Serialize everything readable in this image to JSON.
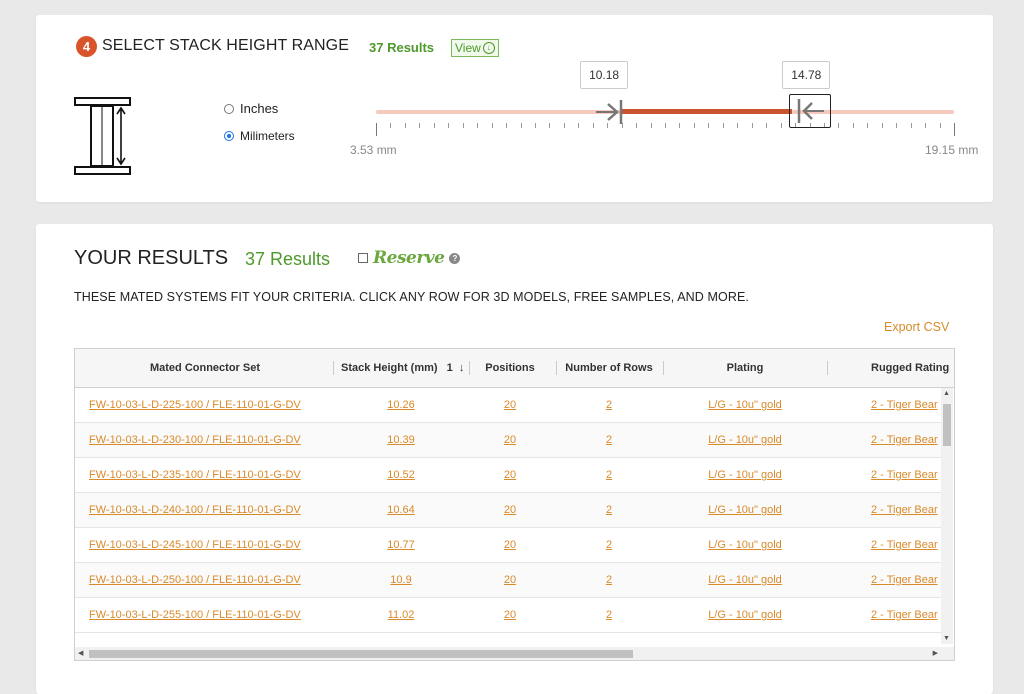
{
  "stack_range": {
    "step_number": "4",
    "title": "SELECT STACK HEIGHT RANGE",
    "results": "37 Results",
    "view_label": "View",
    "units": {
      "inches": "Inches",
      "millimeters": "Milimeters",
      "selected": "millimeters"
    },
    "slider": {
      "min_label": "3.53 mm",
      "max_label": "19.15 mm",
      "min": 3.53,
      "max": 19.15,
      "low_value": "10.18",
      "high_value": "14.78",
      "low": 10.18,
      "high": 14.78
    }
  },
  "results": {
    "title": "YOUR RESULTS",
    "count": "37 Results",
    "reserve_label": "Reserve",
    "help": "?",
    "criteria_text": "THESE MATED SYSTEMS FIT YOUR CRITERIA. CLICK ANY ROW FOR 3D MODELS, FREE SAMPLES, AND MORE.",
    "export_label": "Export CSV",
    "columns": {
      "set": "Mated Connector Set",
      "stack": "Stack Height (mm)",
      "sort_index": "1",
      "positions": "Positions",
      "rows": "Number of Rows",
      "plating": "Plating",
      "rugged": "Rugged Rating"
    },
    "rows": [
      {
        "set": "FW-10-03-L-D-225-100 / FLE-110-01-G-DV",
        "stack": "10.26",
        "positions": "20",
        "rows": "2",
        "plating": "L/G - 10u\" gold",
        "rugged": "2 - Tiger Bear"
      },
      {
        "set": "FW-10-03-L-D-230-100 / FLE-110-01-G-DV",
        "stack": "10.39",
        "positions": "20",
        "rows": "2",
        "plating": "L/G - 10u\" gold",
        "rugged": "2 - Tiger Bear"
      },
      {
        "set": "FW-10-03-L-D-235-100 / FLE-110-01-G-DV",
        "stack": "10.52",
        "positions": "20",
        "rows": "2",
        "plating": "L/G - 10u\" gold",
        "rugged": "2 - Tiger Bear"
      },
      {
        "set": "FW-10-03-L-D-240-100 / FLE-110-01-G-DV",
        "stack": "10.64",
        "positions": "20",
        "rows": "2",
        "plating": "L/G - 10u\" gold",
        "rugged": "2 - Tiger Bear"
      },
      {
        "set": "FW-10-03-L-D-245-100 / FLE-110-01-G-DV",
        "stack": "10.77",
        "positions": "20",
        "rows": "2",
        "plating": "L/G - 10u\" gold",
        "rugged": "2 - Tiger Bear"
      },
      {
        "set": "FW-10-03-L-D-250-100 / FLE-110-01-G-DV",
        "stack": "10.9",
        "positions": "20",
        "rows": "2",
        "plating": "L/G - 10u\" gold",
        "rugged": "2 - Tiger Bear"
      },
      {
        "set": "FW-10-03-L-D-255-100 / FLE-110-01-G-DV",
        "stack": "11.02",
        "positions": "20",
        "rows": "2",
        "plating": "L/G - 10u\" gold",
        "rugged": "2 - Tiger Bear"
      }
    ]
  },
  "colors": {
    "accent": "#d9542b",
    "green": "#4c9a2a",
    "link": "#d98a2a",
    "track": "#f5c9bc",
    "track_selected": "#c9532f"
  },
  "icons": [
    "stack-height-icon",
    "arrow-right-icon",
    "arrow-left-icon",
    "help-icon",
    "sort-down-arrow-icon",
    "view-down-icon"
  ]
}
